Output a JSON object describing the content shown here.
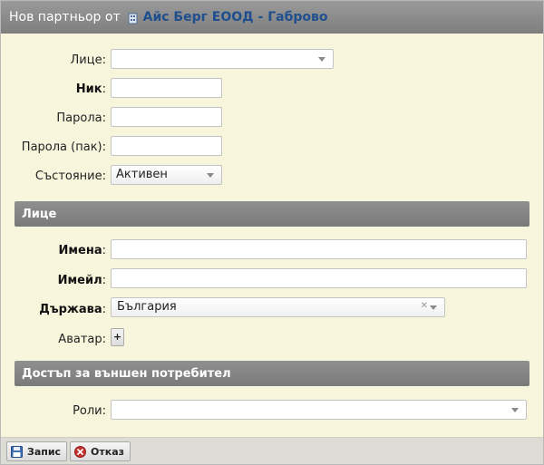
{
  "title": {
    "prefix": "Нов партньор от",
    "partner": "Айс Берг ЕООД - Габрово"
  },
  "form": {
    "person_label": "Лице",
    "nick_label": "Ник",
    "password_label": "Парола:",
    "password_again_label": "Парола (пак):",
    "state_label": "Състояние:",
    "state_value": "Активен"
  },
  "section_person": {
    "title": "Лице",
    "names_label": "Имена",
    "email_label": "Имейл",
    "country_label": "Държава",
    "country_value": "България",
    "avatar_label": "Аватар:",
    "avatar_add": "+"
  },
  "section_access": {
    "title": "Достъп за външен потребител",
    "roles_label": "Роли:"
  },
  "footer": {
    "save_label": "Запис",
    "cancel_label": "Отказ"
  }
}
